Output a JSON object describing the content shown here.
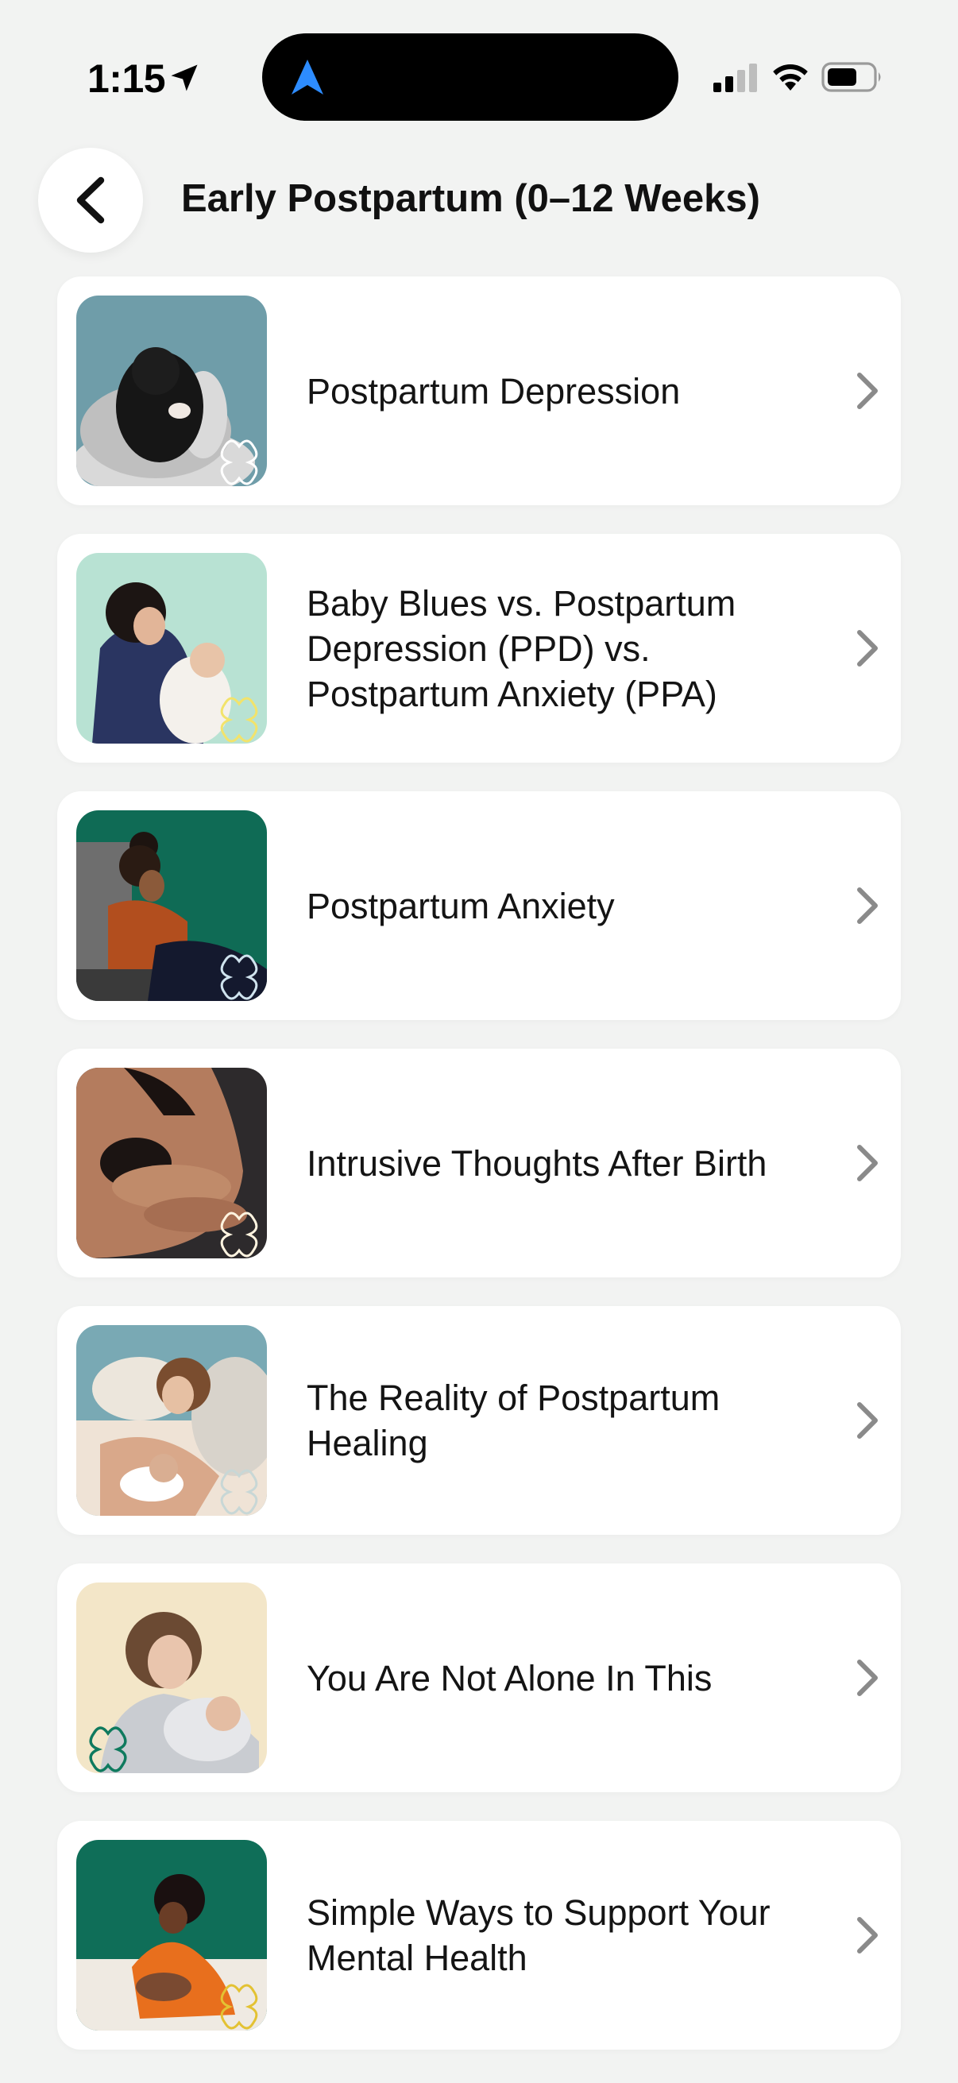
{
  "status_bar": {
    "time": "1:15"
  },
  "header": {
    "title": "Early Postpartum (0–12 Weeks)"
  },
  "articles": [
    {
      "title": "Postpartum Depression",
      "thumb_bg": "#6f9da9",
      "icon": "person-crouching-photo"
    },
    {
      "title": "Baby Blues vs. Postpartum Depression (PPD) vs. Postpartum Anxiety (PPA)",
      "thumb_bg": "#b8e2d3",
      "icon": "mother-holding-baby-photo"
    },
    {
      "title": "Postpartum Anxiety",
      "thumb_bg": "#0f6b55",
      "icon": "mother-nursing-seated-photo"
    },
    {
      "title": "Intrusive Thoughts After Birth",
      "thumb_bg": "#2d2a2c",
      "icon": "mother-skin-to-skin-photo"
    },
    {
      "title": "The Reality of Postpartum Healing",
      "thumb_bg": "#79a9b4",
      "icon": "mother-resting-with-baby-photo"
    },
    {
      "title": "You Are Not Alone In This",
      "thumb_bg": "#f3e6c8",
      "icon": "mother-cradling-baby-photo"
    },
    {
      "title": "Simple Ways to Support Your Mental Health",
      "thumb_bg": "#0f6e58",
      "icon": "mother-holding-newborn-photo"
    }
  ],
  "colors": {
    "background": "#f2f3f2",
    "card": "#ffffff",
    "chevron": "#8a8a8a",
    "nav_arrow": "#2d8cff"
  }
}
